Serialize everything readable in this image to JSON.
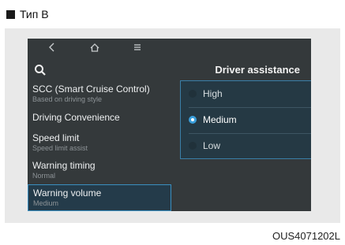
{
  "type_label": "Тип B",
  "screen": {
    "nav": {
      "back_icon": "chevron-left-icon",
      "home_icon": "home-icon",
      "menu_icon": "hamburger-menu-icon"
    },
    "search_icon": "search-icon",
    "right_title": "Driver assistance",
    "menu_items": [
      {
        "label": "SCC (Smart Cruise Control)",
        "sub": "Based on driving style",
        "selected": false
      },
      {
        "label": "Driving Convenience",
        "sub": "",
        "selected": false
      },
      {
        "label": "Speed limit",
        "sub": "Speed limit assist",
        "selected": false
      },
      {
        "label": "Warning timing",
        "sub": "Normal",
        "selected": false
      },
      {
        "label": "Warning volume",
        "sub": "Medium",
        "selected": true
      }
    ],
    "options": [
      {
        "label": "High",
        "selected": false
      },
      {
        "label": "Medium",
        "selected": true
      },
      {
        "label": "Low",
        "selected": false
      }
    ]
  },
  "code_label": "OUS4071202L",
  "colors": {
    "screen_bg": "#34393b",
    "accent": "#3a9fdc",
    "selected_bg": "#243b4a"
  }
}
